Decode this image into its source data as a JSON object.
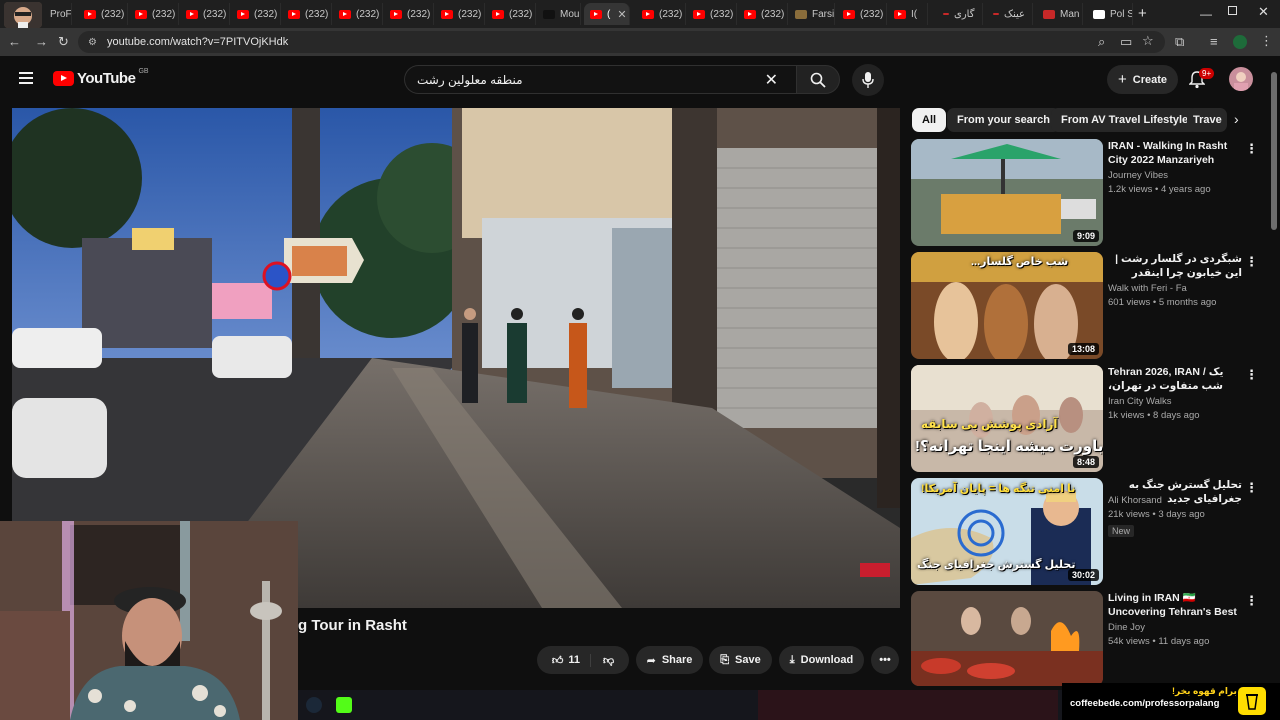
{
  "browser": {
    "tabs": [
      {
        "label": "ProFe",
        "icon": "profile-avatar-icon"
      },
      {
        "label": "(232)",
        "icon": "youtube-icon"
      },
      {
        "label": "(232)",
        "icon": "youtube-icon"
      },
      {
        "label": "(232)",
        "icon": "youtube-icon"
      },
      {
        "label": "(232)",
        "icon": "youtube-icon"
      },
      {
        "label": "(232)",
        "icon": "youtube-icon"
      },
      {
        "label": "(232)",
        "icon": "youtube-icon"
      },
      {
        "label": "(232)",
        "icon": "youtube-icon"
      },
      {
        "label": "(232)",
        "icon": "youtube-icon"
      },
      {
        "label": "(232)",
        "icon": "youtube-icon"
      },
      {
        "label": "Mou",
        "icon": "tiktok-icon"
      },
      {
        "label": "(",
        "icon": "youtube-icon"
      },
      {
        "label": "(232)",
        "icon": "youtube-icon"
      },
      {
        "label": "(232)",
        "icon": "youtube-icon"
      },
      {
        "label": "(232)",
        "icon": "youtube-icon"
      },
      {
        "label": "Farsi",
        "icon": "dictionary-icon"
      },
      {
        "label": "(232)",
        "icon": "youtube-icon"
      },
      {
        "label": "I(",
        "icon": "youtube-icon"
      },
      {
        "label": "گاری",
        "icon": "site-icon"
      },
      {
        "label": "عینک",
        "icon": "site-icon"
      },
      {
        "label": "Man",
        "icon": "chart-site-icon"
      },
      {
        "label": "Pol S",
        "icon": "wikipedia-icon"
      }
    ],
    "url": "youtube.com/watch?v=7PITVOjKHdk"
  },
  "youtube": {
    "logo_text": "YouTube",
    "region": "GB",
    "search_value": "منطقه معلولین رشت",
    "create_label": "Create",
    "notifications_badge": "9+",
    "chips": [
      "All",
      "From your search",
      "From AV Travel Lifestyle",
      "Trave"
    ],
    "video": {
      "title_fragment": "g Tour in Rasht",
      "likes": "11",
      "share_label": "Share",
      "save_label": "Save",
      "download_label": "Download",
      "sign_text": "شاهرخ بی شاهرخ"
    },
    "recommendations": [
      {
        "title": "IRAN - Walking In Rasht City 2022 Manzariyeh Street Ira...",
        "channel": "Journey Vibes",
        "meta": "1.2k views • 4 years ago",
        "duration": "9:09",
        "new": ""
      },
      {
        "title": "شبگردی در گلسار رشت | این خیابون چرا اینقدر وسوسه‌انگیزه؟",
        "channel": "Walk with Feri - Fa",
        "meta": "601 views • 5 months ago",
        "duration": "13:08",
        "new": "",
        "caption": "شب خاص گلسار..."
      },
      {
        "title": "Tehran 2026, IRAN / یک شب متفاوت در تهران، بدون سانسور!!",
        "channel": "Iran City Walks",
        "meta": "1k views • 8 days ago",
        "duration": "8:48",
        "new": "",
        "caption1": "آزادی پوشش بی سابقه",
        "caption2": "باورت میشه اینجا تهرانه؟!"
      },
      {
        "title": "تحلیل گسترش جنگ به جغرافیای جدید",
        "channel": "Ali Khorsand",
        "meta": "21k views • 3 days ago",
        "duration": "30:02",
        "new": "New",
        "caption1": "نا امنی تنگه ها = پایان آمریکا!",
        "caption2": "تحلیل گسترش جغرافیای جنگ"
      },
      {
        "title": "Living in IRAN 🇮🇷 Uncovering Tehran's Best Street Food ...",
        "channel": "Dine Joy",
        "meta": "54k views • 11 days ago",
        "duration": "",
        "new": ""
      }
    ]
  },
  "overlay": {
    "coffee_title": "برام قهوه بخر!",
    "coffee_url": "coffeebede.com/professorpalang"
  },
  "colors": {
    "youtube_red": "#ff0000",
    "background": "#0f0f0f",
    "chip": "#272727"
  }
}
